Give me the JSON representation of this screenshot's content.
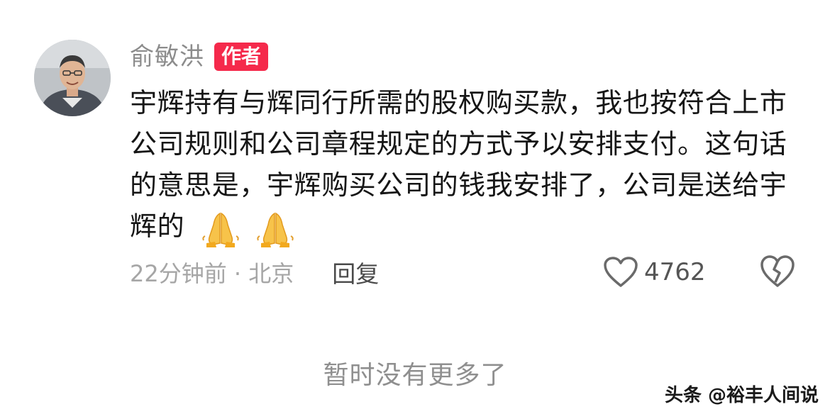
{
  "comment": {
    "author": {
      "name": "俞敏洪",
      "badge": "作者",
      "avatar_icon": "user-avatar-photo"
    },
    "text": "宇辉持有与辉同行所需的股权购买款，我也按符合上市公司规则和公司章程规定的方式予以安排支付。这句话的意思是，宇辉购买公司的钱我安排了，公司是送给宇辉的",
    "emojis": [
      "pray-emoji",
      "pray-emoji"
    ],
    "meta": {
      "time_location": "22分钟前 · 北京",
      "reply_label": "回复"
    },
    "likes": {
      "icon": "heart-outline-icon",
      "count": "4762"
    },
    "dislike_icon": "broken-heart-icon"
  },
  "footer": {
    "no_more": "暂时没有更多了"
  },
  "watermark": "头条 @裕丰人间说",
  "colors": {
    "badge": "#f5294b",
    "name": "#8c8c8c",
    "text": "#161616",
    "meta": "#a6a6a6"
  }
}
